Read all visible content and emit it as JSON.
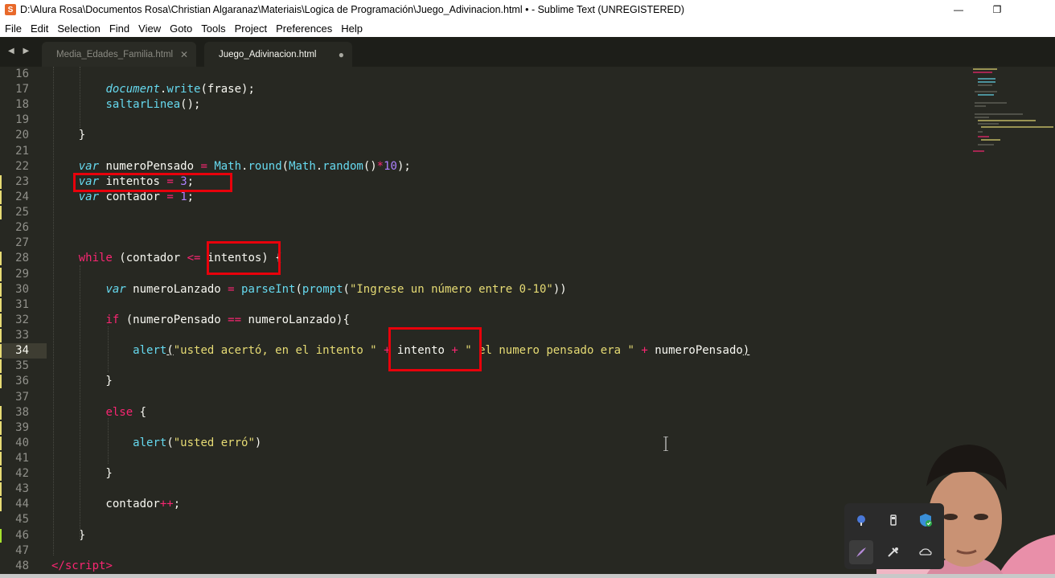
{
  "window": {
    "title": "D:\\Alura Rosa\\Documentos Rosa\\Christian Algaranaz\\Materiais\\Logica de Programación\\Juego_Adivinacion.html • - Sublime Text (UNREGISTERED)",
    "app_icon_letter": "S",
    "minimize_glyph": "—",
    "restore_glyph": "❐",
    "close_glyph": "✕"
  },
  "menu": [
    "File",
    "Edit",
    "Selection",
    "Find",
    "View",
    "Goto",
    "Tools",
    "Project",
    "Preferences",
    "Help"
  ],
  "tabs": [
    {
      "label": "Media_Edades_Familia.html",
      "control": "✕",
      "active": false
    },
    {
      "label": "Juego_Adivinacion.html",
      "control": "●",
      "active": true
    }
  ],
  "nav_arrows": "◀ ▶",
  "editor": {
    "current_line": 34,
    "modified_lines": [
      23,
      24,
      25,
      28,
      29,
      30,
      31,
      32,
      33,
      34,
      35,
      36,
      38,
      39,
      40,
      41,
      42,
      43,
      44,
      46
    ],
    "lines": [
      {
        "n": "16",
        "html": ""
      },
      {
        "n": "17",
        "html": "        <span class=\"kw\">document</span>.<span class=\"fn\">write</span>(frase);"
      },
      {
        "n": "18",
        "html": "        <span class=\"fn\">saltarLinea</span>();"
      },
      {
        "n": "19",
        "html": ""
      },
      {
        "n": "20",
        "html": "    }"
      },
      {
        "n": "21",
        "html": ""
      },
      {
        "n": "22",
        "html": "    <span class=\"kw\">var</span> numeroPensado <span class=\"op\">=</span> <span class=\"fn\">Math</span>.<span class=\"fn\">round</span>(<span class=\"fn\">Math</span>.<span class=\"fn\">random</span>()<span class=\"op\">*</span><span class=\"num\">10</span>);"
      },
      {
        "n": "23",
        "html": "    <span class=\"kw\">var</span> intentos <span class=\"op\">=</span> <span class=\"num\">3</span>;"
      },
      {
        "n": "24",
        "html": "    <span class=\"kw\">var</span> contador <span class=\"op\">=</span> <span class=\"num\">1</span>;"
      },
      {
        "n": "25",
        "html": ""
      },
      {
        "n": "26",
        "html": ""
      },
      {
        "n": "27",
        "html": ""
      },
      {
        "n": "28",
        "html": "    <span class=\"ctrl\">while</span> (contador <span class=\"op\">&lt;=</span> intentos) {"
      },
      {
        "n": "29",
        "html": ""
      },
      {
        "n": "30",
        "html": "        <span class=\"kw\">var</span> numeroLanzado <span class=\"op\">=</span> <span class=\"fn\">parseInt</span>(<span class=\"fn\">prompt</span>(<span class=\"str\">\"Ingrese un número entre 0-10\"</span>))"
      },
      {
        "n": "31",
        "html": ""
      },
      {
        "n": "32",
        "html": "        <span class=\"ctrl\">if</span> (numeroPensado <span class=\"op\">==</span> numeroLanzado){"
      },
      {
        "n": "33",
        "html": ""
      },
      {
        "n": "34",
        "html": "            <span class=\"fn\">alert</span><u>(</u><span class=\"str\">\"usted acertó, en el intento \"</span> <span class=\"op\">+</span> intento <span class=\"op\">+</span> <span class=\"str\">\" el numero pensado era \"</span> <span class=\"op\">+</span> numeroPensado<u>)</u>"
      },
      {
        "n": "35",
        "html": ""
      },
      {
        "n": "36",
        "html": "        }"
      },
      {
        "n": "37",
        "html": ""
      },
      {
        "n": "38",
        "html": "        <span class=\"ctrl\">else</span> {"
      },
      {
        "n": "39",
        "html": ""
      },
      {
        "n": "40",
        "html": "            <span class=\"fn\">alert</span>(<span class=\"str\">\"usted erró\"</span>)"
      },
      {
        "n": "41",
        "html": ""
      },
      {
        "n": "42",
        "html": "        }"
      },
      {
        "n": "43",
        "html": ""
      },
      {
        "n": "44",
        "html": "        contador<span class=\"op\">++</span>;"
      },
      {
        "n": "45",
        "html": ""
      },
      {
        "n": "46",
        "html": "    }"
      },
      {
        "n": "47",
        "html": ""
      },
      {
        "n": "48",
        "html": "<span class=\"op\">&lt;/</span><span class=\"ctrl\">script</span><span class=\"op\">&gt;</span>"
      }
    ]
  },
  "highlight_boxes": [
    "var-intentos-declaration",
    "while-condition-intentos",
    "alert-concat-intento"
  ],
  "tray": {
    "icons": [
      "network-icon",
      "usb-drive-icon",
      "security-shield-icon",
      "pen-icon",
      "tools-icon",
      "cloud-sync-icon"
    ]
  },
  "colors": {
    "background": "#272822",
    "tab_bar": "#1d1e19",
    "keyword": "#66d9ef",
    "operator": "#f92672",
    "string": "#e6db74",
    "number": "#ae81ff",
    "annotation_red": "#e8000b"
  }
}
